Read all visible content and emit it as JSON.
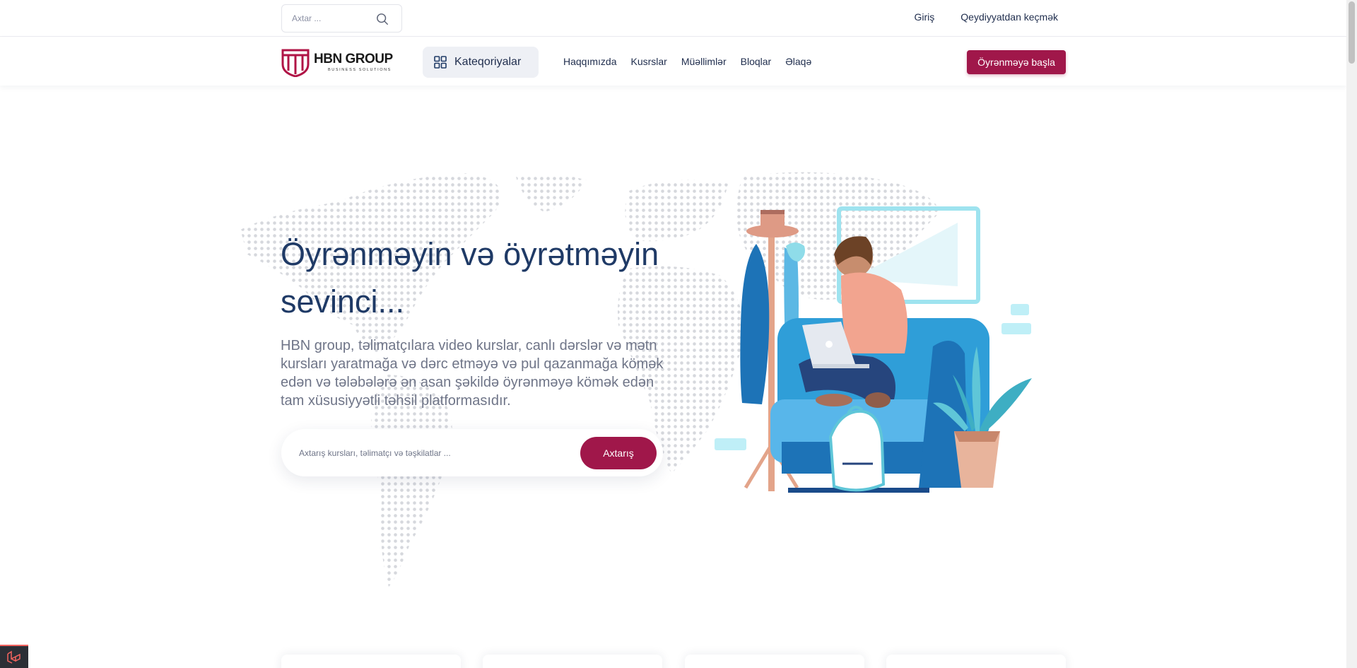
{
  "topbar": {
    "search_placeholder": "Axtar ...",
    "login_label": "Giriş",
    "register_label": "Qeydiyyatdan keçmək"
  },
  "navbar": {
    "logo": {
      "name": "HBN GROUP",
      "tagline": "BUSINESS SOLUTIONS"
    },
    "categories_label": "Kateqoriyalar",
    "links": [
      "Haqqımızda",
      "Kusrslar",
      "Müəllimlər",
      "Bloqlar",
      "Əlaqə"
    ],
    "cta_label": "Öyrənməyə başla"
  },
  "hero": {
    "title": "Öyrənməyin və öyrətməyin sevinci...",
    "description": "HBN group, təlimatçılara video kurslar, canlı dərslər və mətn kursları yaratmağa və dərc etməyə və pul qazanmağa kömək edən və tələbələrə ən asan şəkildə öyrənməyə kömək edən tam xüsusiyyətli təhsil platformasıdır.",
    "search_placeholder": "Axtarış kursları, təlimatçı və təşkilatlar ...",
    "search_button": "Axtarış"
  },
  "colors": {
    "brand": "#a0174a",
    "heading": "#1f3a66",
    "text_muted": "#6f7588",
    "nav_text": "#1f2d4d"
  },
  "icons": {
    "top_search": "search-icon",
    "categories": "grid-icon",
    "debug": "laravel-icon"
  }
}
